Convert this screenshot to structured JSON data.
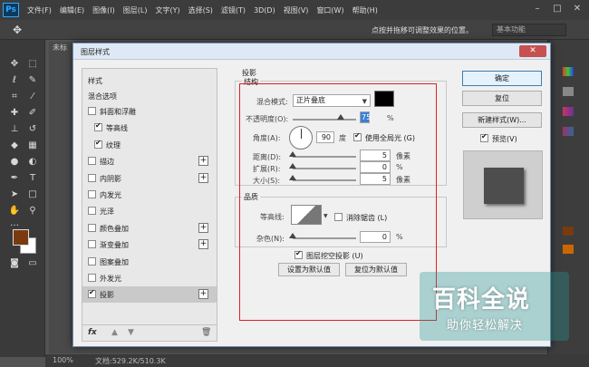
{
  "app": {
    "logo": "Ps"
  },
  "menu": [
    "文件(F)",
    "编辑(E)",
    "图像(I)",
    "图层(L)",
    "文字(Y)",
    "选择(S)",
    "滤镜(T)",
    "3D(D)",
    "视图(V)",
    "窗口(W)",
    "帮助(H)"
  ],
  "window_controls": [
    "–",
    "□",
    "✕"
  ],
  "options_bar": {
    "hint": "点按并拖移可调整效果的位置。",
    "workspace": "基本功能"
  },
  "document": {
    "tab": "未标",
    "zoom": "100%",
    "info": "文档:529.2K/510.3K"
  },
  "dialog": {
    "title": "图层样式",
    "close": "✕",
    "style_list": {
      "header": "样式",
      "blend_options": "混合选项",
      "items": [
        {
          "label": "斜面和浮雕",
          "checked": false,
          "has_plus": false,
          "indent": false
        },
        {
          "label": "等高线",
          "checked": true,
          "has_plus": false,
          "indent": true
        },
        {
          "label": "纹理",
          "checked": true,
          "has_plus": false,
          "indent": true
        },
        {
          "label": "描边",
          "checked": false,
          "has_plus": true,
          "indent": false
        },
        {
          "label": "内阴影",
          "checked": false,
          "has_plus": true,
          "indent": false
        },
        {
          "label": "内发光",
          "checked": false,
          "has_plus": false,
          "indent": false
        },
        {
          "label": "光泽",
          "checked": false,
          "has_plus": false,
          "indent": false
        },
        {
          "label": "颜色叠加",
          "checked": false,
          "has_plus": true,
          "indent": false
        },
        {
          "label": "渐变叠加",
          "checked": false,
          "has_plus": true,
          "indent": false
        },
        {
          "label": "图案叠加",
          "checked": false,
          "has_plus": false,
          "indent": false
        },
        {
          "label": "外发光",
          "checked": false,
          "has_plus": false,
          "indent": false
        },
        {
          "label": "投影",
          "checked": true,
          "has_plus": true,
          "indent": false,
          "selected": true
        }
      ],
      "footer_fx": "fx"
    },
    "drop_shadow": {
      "title": "投影",
      "structure": {
        "title": "结构",
        "blend_mode_label": "混合模式:",
        "blend_mode_value": "正片叠底",
        "shadow_color": "#000000",
        "opacity_label": "不透明度(O):",
        "opacity_value": "75",
        "opacity_unit": "%",
        "angle_label": "角度(A):",
        "angle_value": "90",
        "angle_unit": "度",
        "global_light_label": "使用全局光 (G)",
        "global_light_checked": true,
        "distance_label": "距离(D):",
        "distance_value": "5",
        "distance_unit": "像素",
        "spread_label": "扩展(R):",
        "spread_value": "0",
        "spread_unit": "%",
        "size_label": "大小(S):",
        "size_value": "5",
        "size_unit": "像素"
      },
      "quality": {
        "title": "品质",
        "contour_label": "等高线:",
        "anti_alias_label": "消除锯齿 (L)",
        "noise_label": "杂色(N):",
        "noise_value": "0",
        "noise_unit": "%"
      },
      "knockout_label": "图层挖空投影 (U)",
      "knockout_checked": true,
      "set_default": "设置为默认值",
      "reset_default": "复位为默认值"
    },
    "buttons": {
      "ok": "确定",
      "reset": "复位",
      "new_style": "新建样式(W)...",
      "preview": "预览(V)",
      "preview_checked": true
    }
  },
  "watermark": {
    "title": "百科全说",
    "subtitle": "助你轻松解决"
  },
  "colors": {
    "foreground": "#7a3a10",
    "background": "#ffffff",
    "highlight": "#e02020"
  }
}
